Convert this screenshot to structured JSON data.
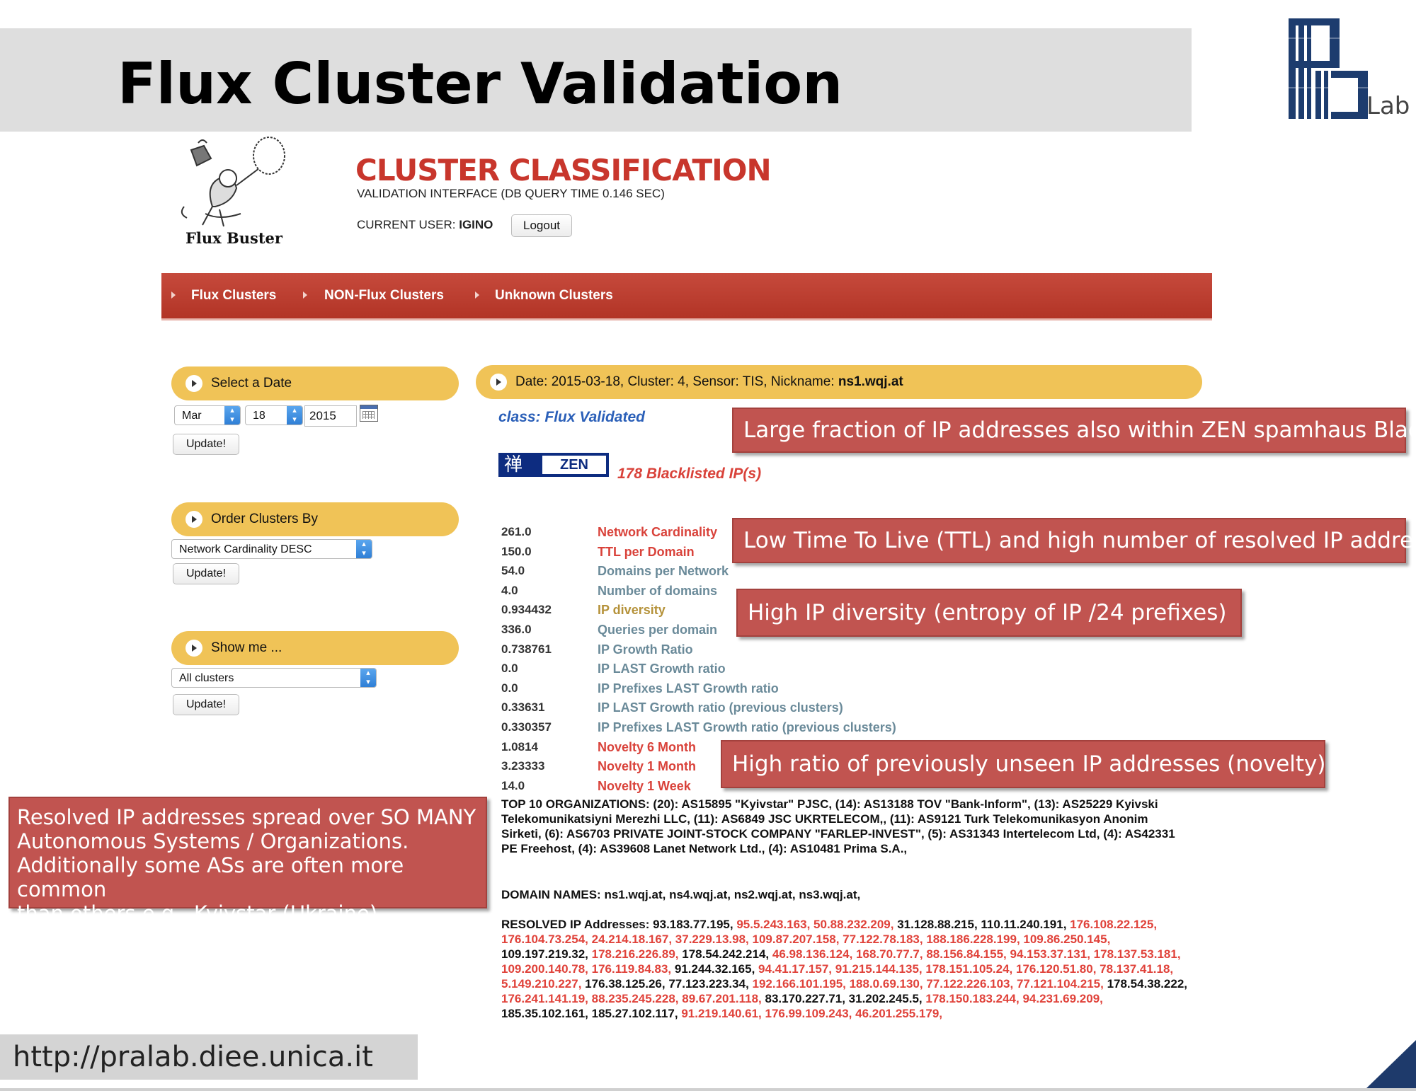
{
  "slide": {
    "title": "Flux Cluster Validation",
    "footer_url": "http://pralab.diee.unica.it",
    "logo_text": "Lab"
  },
  "app": {
    "mascot_label": "Flux Buster",
    "title": "CLUSTER CLASSIFICATION",
    "subtitle": "VALIDATION INTERFACE (DB QUERY TIME 0.146 SEC)",
    "current_user_label": "CURRENT USER:",
    "current_user": "IGINO",
    "logout_label": "Logout"
  },
  "nav": {
    "items": [
      "Flux Clusters",
      "NON-Flux Clusters",
      "Unknown Clusters"
    ]
  },
  "sidebar": {
    "date_panel": {
      "header": "Select a Date",
      "month": "Mar",
      "day": "18",
      "year": "2015",
      "update_label": "Update!"
    },
    "order_panel": {
      "header": "Order Clusters By",
      "selected": "Network Cardinality DESC",
      "update_label": "Update!"
    },
    "show_panel": {
      "header": "Show me ...",
      "selected": "All clusters",
      "update_label": "Update!"
    }
  },
  "cluster": {
    "header_prefix": "Date: 2015-03-18, Cluster: 4, Sensor: TIS, Nickname: ",
    "nickname": "ns1.wqj.at",
    "class_label": "class: Flux Validated",
    "zen_label": "ZEN",
    "zen_kanji": "禅",
    "blacklisted": "178 Blacklisted IP(s)",
    "metrics": [
      {
        "value": "261.0",
        "name": "Network Cardinality",
        "tone": "red"
      },
      {
        "value": "150.0",
        "name": "TTL per Domain",
        "tone": "red"
      },
      {
        "value": "54.0",
        "name": "Domains per Network",
        "tone": "grey"
      },
      {
        "value": "4.0",
        "name": "Number of domains",
        "tone": "grey"
      },
      {
        "value": "0.934432",
        "name": "IP diversity",
        "tone": "gold"
      },
      {
        "value": "336.0",
        "name": "Queries per domain",
        "tone": "grey"
      },
      {
        "value": "0.738761",
        "name": "IP Growth Ratio",
        "tone": "grey"
      },
      {
        "value": "0.0",
        "name": "IP LAST Growth ratio",
        "tone": "grey"
      },
      {
        "value": "0.0",
        "name": "IP Prefixes LAST Growth ratio",
        "tone": "grey"
      },
      {
        "value": "0.33631",
        "name": "IP LAST Growth ratio (previous clusters)",
        "tone": "grey"
      },
      {
        "value": "0.330357",
        "name": "IP Prefixes LAST Growth ratio (previous clusters)",
        "tone": "grey"
      },
      {
        "value": "1.0814",
        "name": "Novelty 6 Month",
        "tone": "red"
      },
      {
        "value": "3.23333",
        "name": "Novelty 1 Month",
        "tone": "red"
      },
      {
        "value": "14.0",
        "name": "Novelty 1 Week",
        "tone": "red"
      }
    ],
    "top_orgs": "TOP 10 ORGANIZATIONS: (20): AS15895 \"Kyivstar\" PJSC, (14): AS13188 TOV \"Bank-Inform\", (13): AS25229 Kyivski Telekomunikatsiyni Merezhi LLC, (11): AS6849 JSC UKRTELECOM,, (11): AS9121 Turk Telekomunikasyon Anonim Sirketi, (6): AS6703 PRIVATE JOINT-STOCK COMPANY \"FARLEP-INVEST\", (5): AS31343 Intertelecom Ltd, (4): AS42331 PE Freehost, (4): AS39608 Lanet Network Ltd., (4): AS10481 Prima S.A.,",
    "domain_names": "DOMAIN NAMES: ns1.wqj.at, ns4.wqj.at, ns2.wqj.at, ns3.wqj.at,",
    "resolved_label": "RESOLVED IP Addresses:",
    "resolved_ips": [
      {
        "ip": "93.183.77.195",
        "red": false
      },
      {
        "ip": "95.5.243.163",
        "red": true
      },
      {
        "ip": "50.88.232.209",
        "red": true
      },
      {
        "ip": "31.128.88.215",
        "red": false
      },
      {
        "ip": "110.11.240.191",
        "red": false
      },
      {
        "ip": "176.108.22.125",
        "red": true
      },
      {
        "ip": "176.104.73.254",
        "red": true
      },
      {
        "ip": "24.214.18.167",
        "red": true
      },
      {
        "ip": "37.229.13.98",
        "red": true
      },
      {
        "ip": "109.87.207.158",
        "red": true
      },
      {
        "ip": "77.122.78.183",
        "red": true
      },
      {
        "ip": "188.186.228.199",
        "red": true
      },
      {
        "ip": "109.86.250.145",
        "red": true
      },
      {
        "ip": "109.197.219.32",
        "red": false
      },
      {
        "ip": "178.216.226.89",
        "red": true
      },
      {
        "ip": "178.54.242.214",
        "red": false
      },
      {
        "ip": "46.98.136.124",
        "red": true
      },
      {
        "ip": "168.70.77.7",
        "red": true
      },
      {
        "ip": "88.156.84.155",
        "red": true
      },
      {
        "ip": "94.153.37.131",
        "red": true
      },
      {
        "ip": "178.137.53.181",
        "red": true
      },
      {
        "ip": "109.200.140.78",
        "red": true
      },
      {
        "ip": "176.119.84.83",
        "red": true
      },
      {
        "ip": "91.244.32.165",
        "red": false
      },
      {
        "ip": "94.41.17.157",
        "red": true
      },
      {
        "ip": "91.215.144.135",
        "red": true
      },
      {
        "ip": "178.151.105.24",
        "red": true
      },
      {
        "ip": "176.120.51.80",
        "red": true
      },
      {
        "ip": "78.137.41.18",
        "red": true
      },
      {
        "ip": "5.149.210.227",
        "red": true
      },
      {
        "ip": "176.38.125.26",
        "red": false
      },
      {
        "ip": "77.123.223.34",
        "red": false
      },
      {
        "ip": "192.166.101.195",
        "red": true
      },
      {
        "ip": "188.0.69.130",
        "red": true
      },
      {
        "ip": "77.122.226.103",
        "red": true
      },
      {
        "ip": "77.121.104.215",
        "red": true
      },
      {
        "ip": "178.54.38.222",
        "red": false
      },
      {
        "ip": "176.241.141.19",
        "red": true
      },
      {
        "ip": "88.235.245.228",
        "red": true
      },
      {
        "ip": "89.67.201.118",
        "red": true
      },
      {
        "ip": "83.170.227.71",
        "red": false
      },
      {
        "ip": "31.202.245.5",
        "red": false
      },
      {
        "ip": "178.150.183.244",
        "red": true
      },
      {
        "ip": "94.231.69.209",
        "red": true
      },
      {
        "ip": "185.35.102.161",
        "red": false
      },
      {
        "ip": "185.27.102.117",
        "red": false
      },
      {
        "ip": "91.219.140.61",
        "red": true
      },
      {
        "ip": "176.99.109.243",
        "red": true
      },
      {
        "ip": "46.201.255.179",
        "red": true
      }
    ]
  },
  "callouts": {
    "zen": "Large fraction of IP addresses also within ZEN spamhaus Blacklist",
    "ttl": "Low Time To Live (TTL) and high number of resolved IP addresses",
    "diversity": "High IP diversity (entropy of IP /24 prefixes)",
    "novelty": "High ratio of previously unseen IP addresses (novelty)",
    "as_lines": [
      "Resolved IP addresses spread over SO MANY",
      "Autonomous Systems / Organizations.",
      "Additionally some ASs are often more common",
      "than others e.g., Kyivstar (Ukraine)"
    ]
  },
  "colors": {
    "accent_red": "#c8362c",
    "nav_red": "#b83a2c",
    "panel_yellow": "#f0c357",
    "callout_red": "#c15450",
    "link_blue": "#2a5fb8"
  }
}
